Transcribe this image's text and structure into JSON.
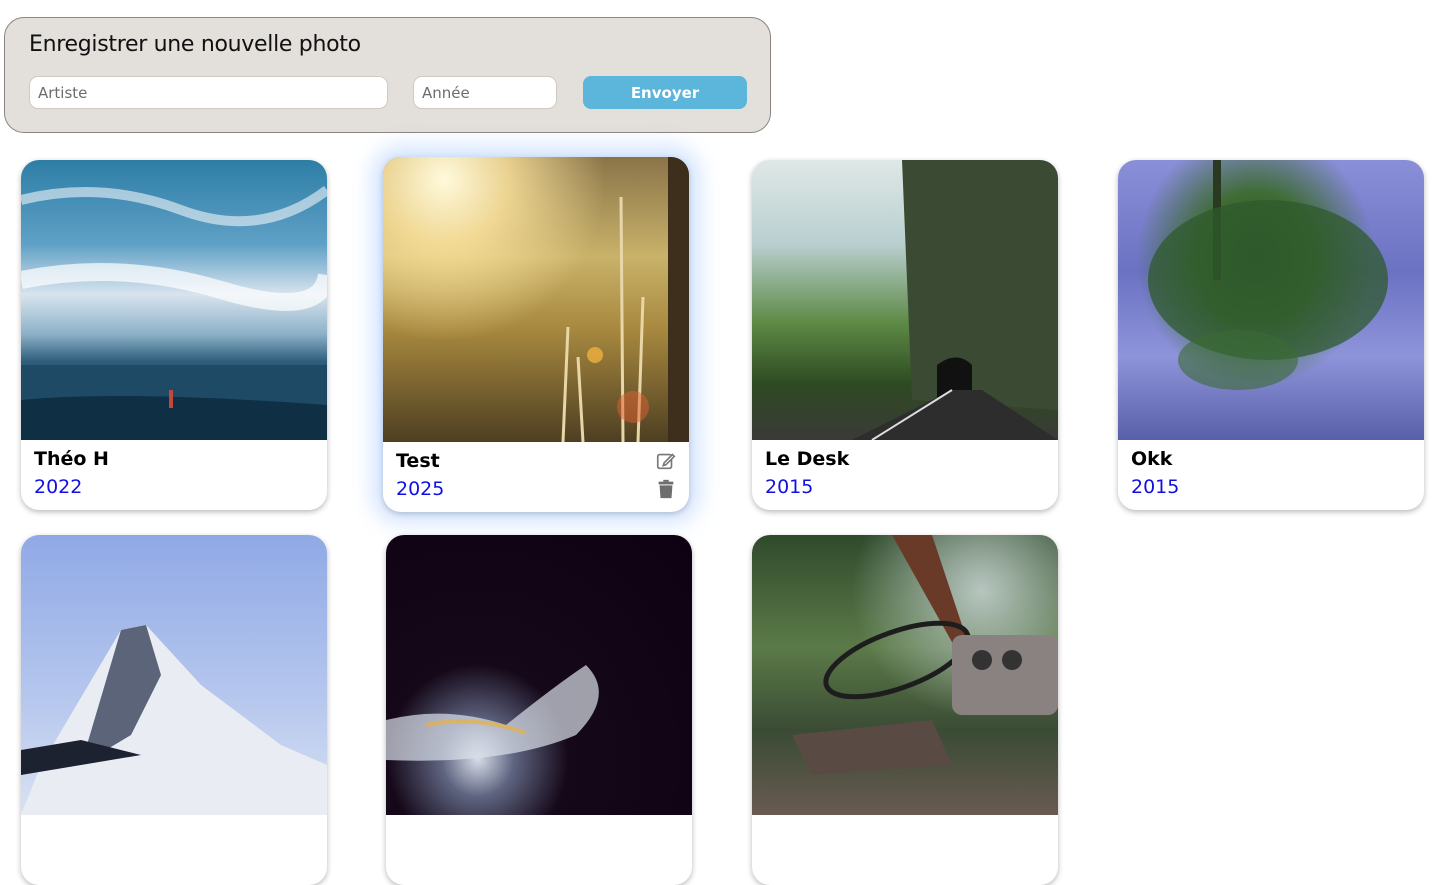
{
  "form": {
    "title": "Enregistrer une nouvelle photo",
    "artist_placeholder": "Artiste",
    "year_placeholder": "Année",
    "submit_label": "Envoyer"
  },
  "cards": [
    {
      "artist": "Théo H",
      "year": "2022",
      "image": "sea-paddleboard"
    },
    {
      "artist": "Test",
      "year": "2025",
      "image": "sunlit-grass"
    },
    {
      "artist": "Le Desk",
      "year": "2015",
      "image": "mountain-road-tunnel"
    },
    {
      "artist": "Okk",
      "year": "2015",
      "image": "tree-reflection"
    },
    {
      "artist": "",
      "year": "",
      "image": "snowy-mountain-peak"
    },
    {
      "artist": "",
      "year": "",
      "image": "smoke-dark"
    },
    {
      "artist": "",
      "year": "",
      "image": "abandoned-car-interior"
    }
  ],
  "icons": {
    "edit": "edit-icon",
    "delete": "trash-icon"
  },
  "colors": {
    "year_text": "#1010e0",
    "submit_button": "#5cb6db",
    "form_background": "#e3dfda"
  }
}
